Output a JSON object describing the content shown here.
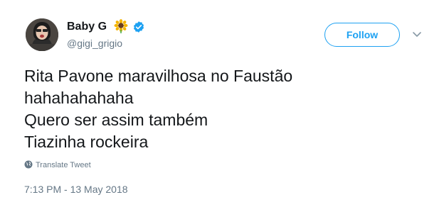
{
  "user": {
    "display_name": "Baby G",
    "handle": "@gigi_grigio",
    "emoji_icon": "sunflower-icon",
    "verified_icon": "verified-badge-icon",
    "verified_color": "#1da1f2"
  },
  "follow_button": {
    "label": "Follow",
    "color": "#1da1f2"
  },
  "menu_icon": "chevron-down-icon",
  "tweet": {
    "lines": [
      "Rita Pavone maravilhosa no Faustão",
      "hahahahahaha",
      "Quero ser assim também",
      "Tiazinha rockeira"
    ]
  },
  "translate": {
    "icon": "globe-icon",
    "label": "Translate Tweet"
  },
  "timestamp": "7:13 PM - 13 May 2018"
}
